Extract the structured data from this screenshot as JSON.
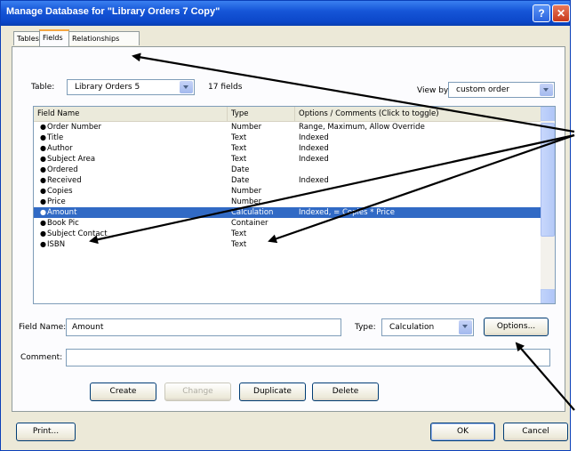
{
  "window": {
    "title": "Manage Database for \"Library Orders 7 Copy\"",
    "help_label": "?",
    "close_label": "✕"
  },
  "tabs": [
    {
      "label": "Tables"
    },
    {
      "label": "Fields"
    },
    {
      "label": "Relationships"
    }
  ],
  "table_selector": {
    "label": "Table:",
    "value": "Library Orders 5",
    "field_count": "17 fields"
  },
  "view_by": {
    "label": "View by:",
    "value": "custom order"
  },
  "columns": {
    "name": "Field Name",
    "type": "Type",
    "options": "Options / Comments   (Click to toggle)"
  },
  "fields": [
    {
      "name": "Order Number",
      "type": "Number",
      "options": "Range, Maximum, Allow Override"
    },
    {
      "name": "Title",
      "type": "Text",
      "options": "Indexed"
    },
    {
      "name": "Author",
      "type": "Text",
      "options": "Indexed"
    },
    {
      "name": "Subject Area",
      "type": "Text",
      "options": "Indexed"
    },
    {
      "name": "Ordered",
      "type": "Date",
      "options": ""
    },
    {
      "name": "Received",
      "type": "Date",
      "options": "Indexed"
    },
    {
      "name": "Copies",
      "type": "Number",
      "options": ""
    },
    {
      "name": "Price",
      "type": "Number",
      "options": ""
    },
    {
      "name": "Amount",
      "type": "Calculation",
      "options": "Indexed, = Copies * Price"
    },
    {
      "name": "Book Pic",
      "type": "Container",
      "options": ""
    },
    {
      "name": "Subject Contact",
      "type": "Text",
      "options": ""
    },
    {
      "name": "ISBN",
      "type": "Text",
      "options": ""
    }
  ],
  "selected_index": 8,
  "field_name": {
    "label": "Field Name:",
    "value": "Amount"
  },
  "type_select": {
    "label": "Type:",
    "value": "Calculation"
  },
  "options_button": "Options...",
  "comment": {
    "label": "Comment:",
    "value": ""
  },
  "actions": {
    "create": "Create",
    "change": "Change",
    "duplicate": "Duplicate",
    "delete": "Delete"
  },
  "footer": {
    "print": "Print...",
    "ok": "OK",
    "cancel": "Cancel"
  },
  "colors": {
    "titlebar": "#0b46c8",
    "selection": "#316ac5",
    "tab_highlight": "#f5a640",
    "annotation_arrow": "#000000"
  }
}
